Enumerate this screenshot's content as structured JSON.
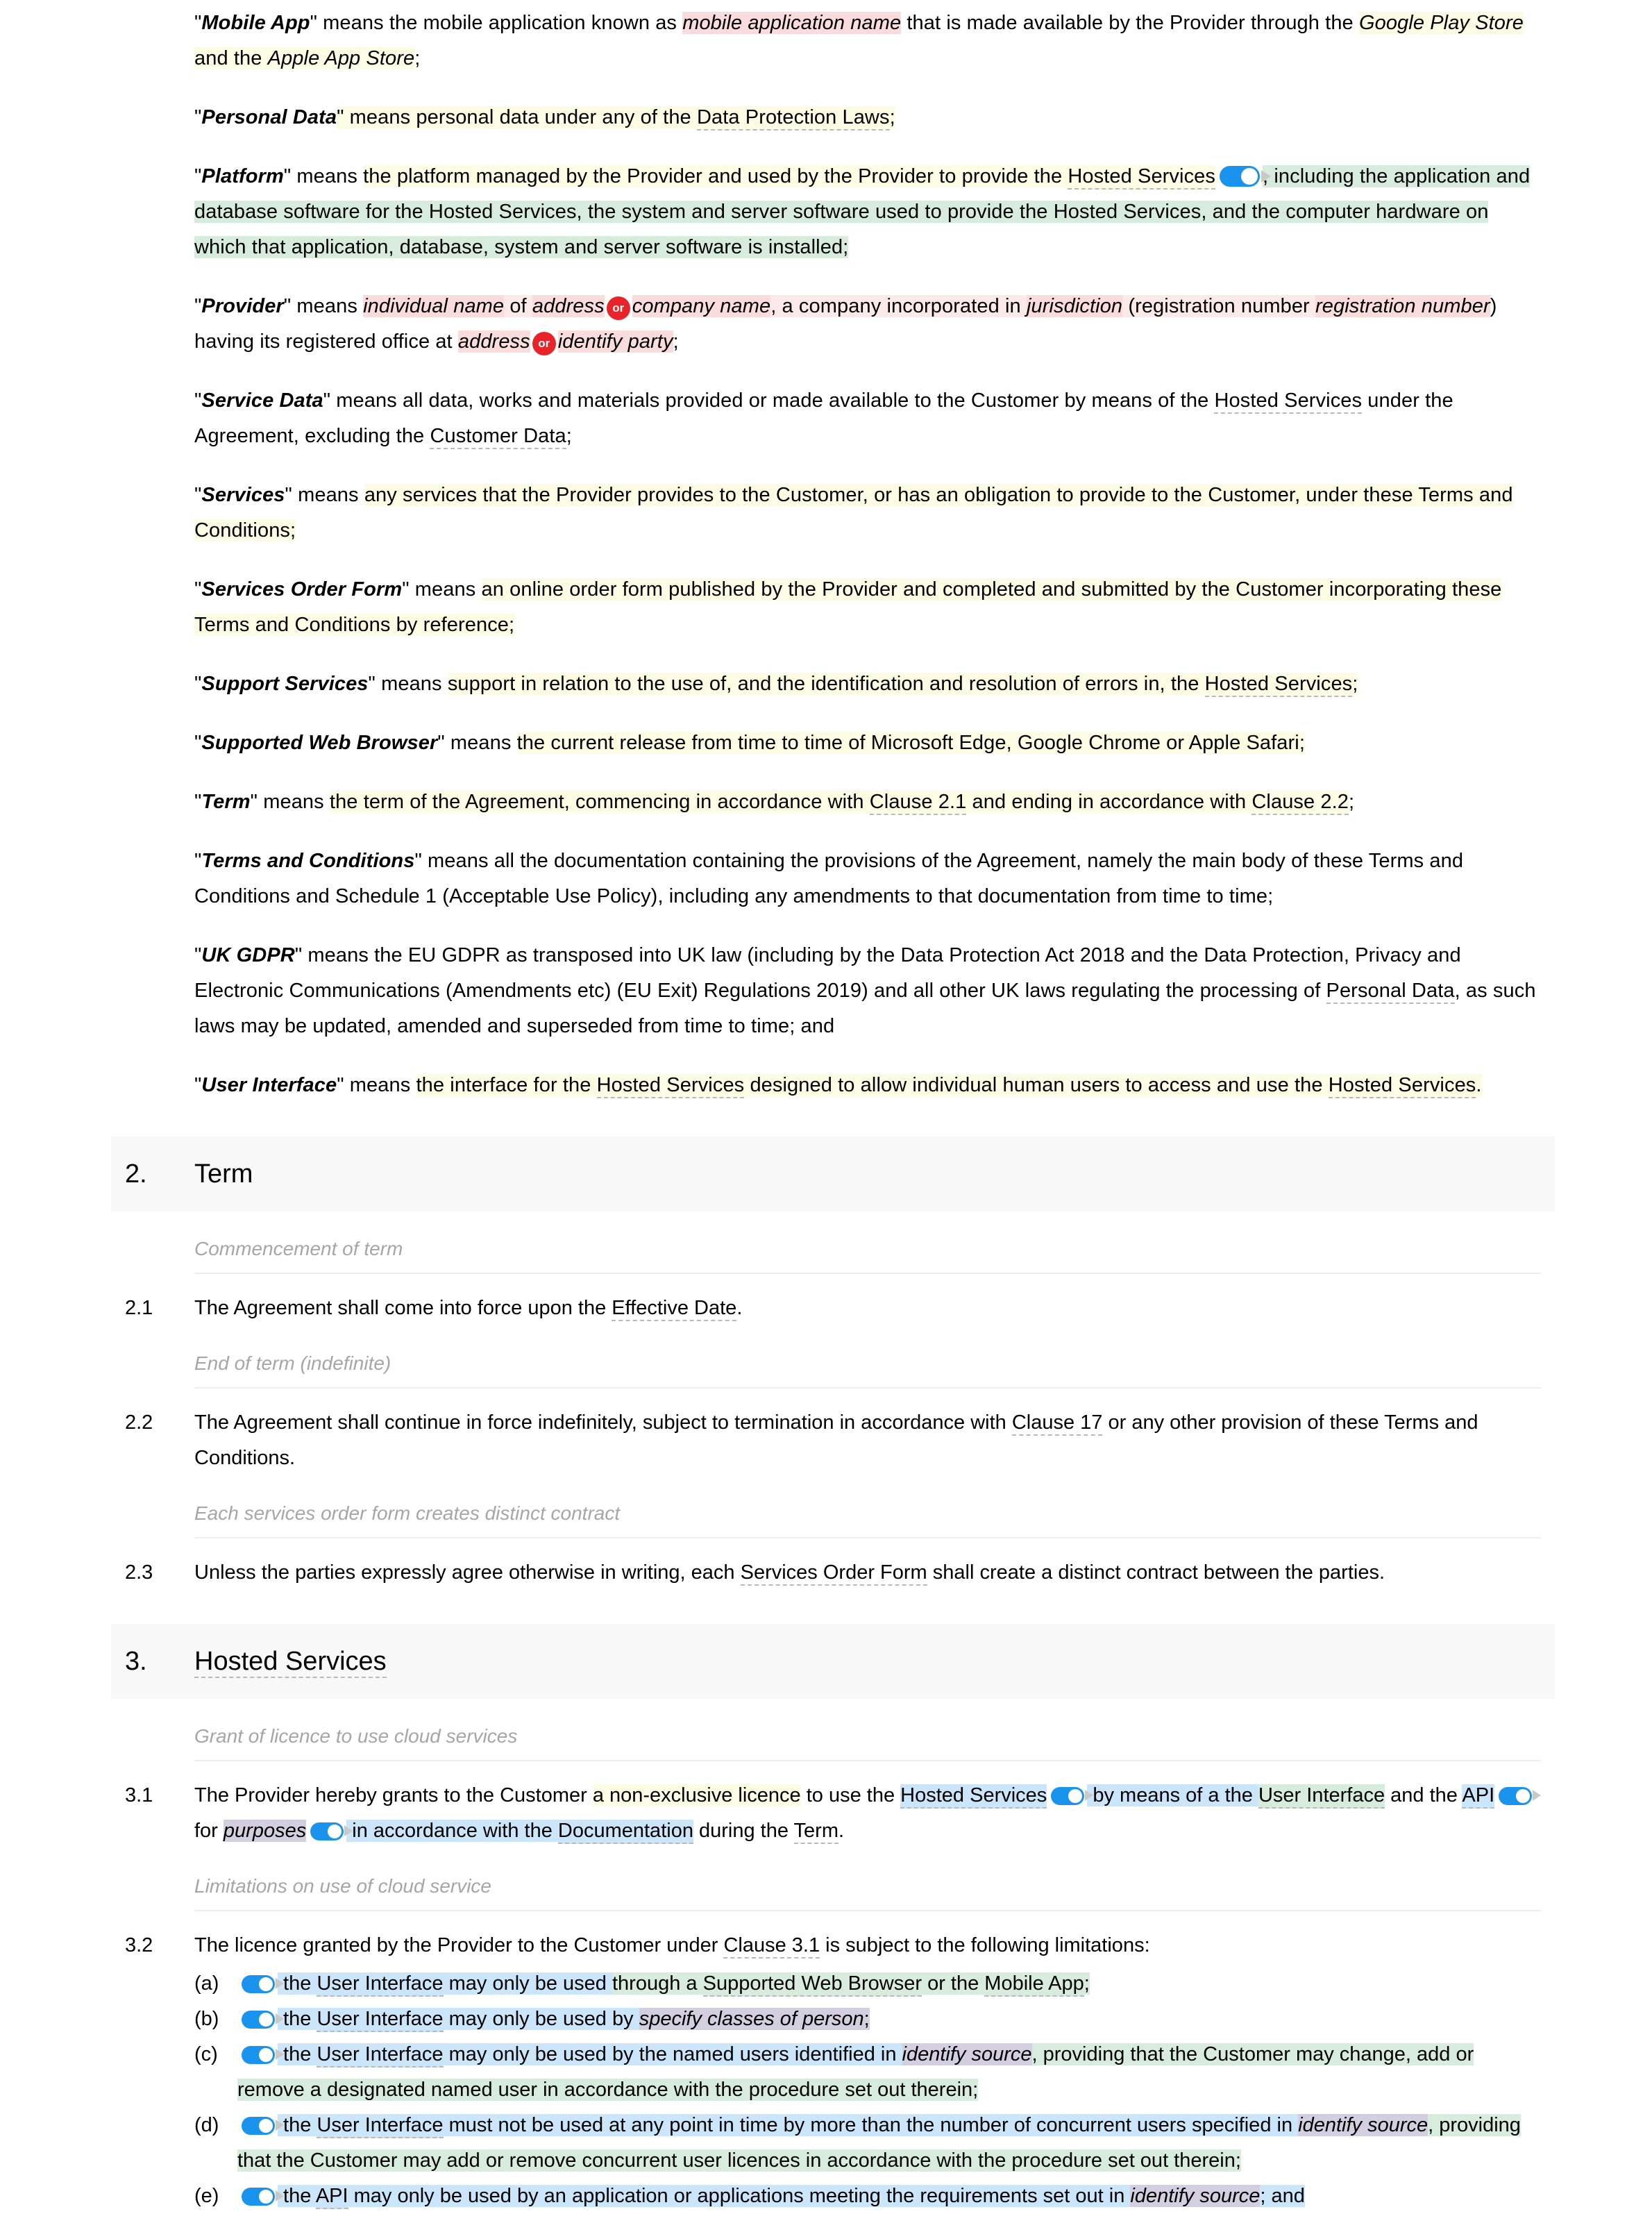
{
  "document": {
    "type": "legal-contract-template",
    "title": "Terms and Conditions — Definitions, Term, Hosted Services"
  },
  "colors": {
    "highlight_yellow": "#fcfbe3",
    "highlight_pink": "#fbdcdc",
    "highlight_pink_light": "#fceaea",
    "highlight_blue": "#cbe6fa",
    "highlight_green": "#d8ecdd",
    "highlight_purple": "#d4cfe0",
    "highlight_grey": "#eceef0",
    "toggle_on": "#1a93ef",
    "or_badge": "#e8232a",
    "section_band": "#f8f8f8",
    "dashed_underline": "#b9b9b9",
    "subheading_text": "#a6a6a6"
  },
  "definitions": [
    {
      "term": "Mobile App",
      "parts": [
        {
          "t": "\" ",
          "k": "quote-open"
        },
        {
          "t": "\" means the mobile application known as ",
          "k": "plain"
        },
        {
          "t": "mobile application name",
          "k": "pink-italic"
        },
        {
          "t": " that is made available by the Provider through the ",
          "k": "plain"
        },
        {
          "t": "Google Play Store",
          "k": "yellow-italic"
        },
        {
          "t": " and the ",
          "k": "yellow"
        },
        {
          "t": "Apple App Store",
          "k": "yellow-italic"
        },
        {
          "t": ";",
          "k": "plain"
        }
      ]
    },
    {
      "term": "Personal Data",
      "parts": [
        {
          "t": "\" means personal data under any of the ",
          "k": "yellow"
        },
        {
          "t": "Data Protection Laws",
          "k": "yellow-dt"
        },
        {
          "t": ";",
          "k": "yellow"
        }
      ]
    },
    {
      "term": "Platform",
      "parts": [
        {
          "t": "\" means ",
          "k": "plain"
        },
        {
          "t": "the platform managed by the Provider and used by the Provider to provide the ",
          "k": "yellow"
        },
        {
          "t": "Hosted Services",
          "k": "yellow-dt"
        },
        {
          "t": "TOGGLE",
          "k": "toggle-blue"
        },
        {
          "t": ", including the application and database software for the Hosted Services, the system and server software used to provide the Hosted Services, and the computer hardware on which that application, database, system and server software is installed;",
          "k": "green"
        }
      ]
    },
    {
      "term": "Provider",
      "parts": [
        {
          "t": "\" means ",
          "k": "plain"
        },
        {
          "t": "individual name",
          "k": "pink-italic"
        },
        {
          "t": " of ",
          "k": "pink-lt"
        },
        {
          "t": "address",
          "k": "pink-italic"
        },
        {
          "t": "OR",
          "k": "or-badge"
        },
        {
          "t": "company name",
          "k": "pink-italic"
        },
        {
          "t": ", a company incorporated in ",
          "k": "pink-lt"
        },
        {
          "t": "jurisdiction",
          "k": "pink-italic"
        },
        {
          "t": " (registration number ",
          "k": "pink-lt"
        },
        {
          "t": "registration number",
          "k": "pink-italic"
        },
        {
          "t": ") having its registered office at ",
          "k": "plain"
        },
        {
          "t": "address",
          "k": "pink-italic"
        },
        {
          "t": "OR",
          "k": "or-badge"
        },
        {
          "t": "identify party",
          "k": "pink-italic"
        },
        {
          "t": ";",
          "k": "plain"
        }
      ]
    },
    {
      "term": "Service Data",
      "parts": [
        {
          "t": "\" means all data, works and materials provided or made available to the Customer by means of the ",
          "k": "plain"
        },
        {
          "t": "Hosted Services",
          "k": "dt"
        },
        {
          "t": " under the Agreement, excluding the ",
          "k": "plain"
        },
        {
          "t": "Customer Data",
          "k": "dt"
        },
        {
          "t": ";",
          "k": "plain"
        }
      ]
    },
    {
      "term": "Services",
      "parts": [
        {
          "t": "\" means ",
          "k": "plain"
        },
        {
          "t": "any services that the Provider provides to the Customer, or has an obligation to provide to the Customer, under these Terms and Conditions;",
          "k": "yellow"
        }
      ]
    },
    {
      "term": "Services Order Form",
      "parts": [
        {
          "t": "\" means ",
          "k": "plain"
        },
        {
          "t": "an online order form published by the Provider and completed and submitted by the Customer incorporating these Terms and Conditions by reference;",
          "k": "yellow"
        }
      ]
    },
    {
      "term": "Support Services",
      "parts": [
        {
          "t": "\" means ",
          "k": "plain"
        },
        {
          "t": "support in relation to the use of, and the identification and resolution of errors in, the ",
          "k": "yellow"
        },
        {
          "t": "Hosted Services",
          "k": "yellow-dt"
        },
        {
          "t": ";",
          "k": "yellow"
        }
      ]
    },
    {
      "term": "Supported Web Browser",
      "parts": [
        {
          "t": "\" means ",
          "k": "plain"
        },
        {
          "t": "the current release from time to time of Microsoft Edge, Google Chrome or Apple Safari;",
          "k": "yellow"
        }
      ]
    },
    {
      "term": "Term",
      "parts": [
        {
          "t": "\" means ",
          "k": "plain"
        },
        {
          "t": "the term of the Agreement, commencing in accordance with ",
          "k": "yellow"
        },
        {
          "t": "Clause 2.1",
          "k": "yellow-dt"
        },
        {
          "t": " and ending in accordance with ",
          "k": "yellow"
        },
        {
          "t": "Clause 2.2",
          "k": "yellow-dt"
        },
        {
          "t": ";",
          "k": "plain"
        }
      ]
    },
    {
      "term": "Terms and Conditions",
      "parts": [
        {
          "t": "\" means all the documentation containing the provisions of the Agreement, namely the main body of these Terms and Conditions and Schedule 1 (Acceptable Use Policy), including any amendments to that documentation from time to time;",
          "k": "plain"
        }
      ]
    },
    {
      "term": "UK GDPR",
      "parts": [
        {
          "t": "\" means the EU GDPR as transposed into UK law (including by the Data Protection Act 2018 and the Data Protection, Privacy and Electronic Communications (Amendments etc) (EU Exit) Regulations 2019) and all other UK laws regulating the processing of ",
          "k": "plain"
        },
        {
          "t": "Personal Data",
          "k": "dt"
        },
        {
          "t": ", as such laws may be updated, amended and superseded from time to time; and",
          "k": "plain"
        }
      ]
    },
    {
      "term": "User Interface",
      "parts": [
        {
          "t": "\" means ",
          "k": "plain"
        },
        {
          "t": "the interface for the ",
          "k": "yellow"
        },
        {
          "t": "Hosted Services",
          "k": "yellow-dt"
        },
        {
          "t": " designed to allow individual human users to access and use the ",
          "k": "yellow"
        },
        {
          "t": "Hosted Services",
          "k": "yellow-dt"
        },
        {
          "t": ".",
          "k": "yellow"
        }
      ]
    }
  ],
  "section_2": {
    "number": "2.",
    "title": "Term",
    "groups": [
      {
        "subheading": "Commencement of term",
        "clauses": [
          {
            "number": "2.1",
            "parts": [
              {
                "t": "The Agreement shall come into force upon the ",
                "k": "plain"
              },
              {
                "t": "Effective Date",
                "k": "dt"
              },
              {
                "t": ".",
                "k": "plain"
              }
            ]
          }
        ]
      },
      {
        "subheading": "End of term (indefinite)",
        "clauses": [
          {
            "number": "2.2",
            "parts": [
              {
                "t": "The Agreement shall continue in force indefinitely, subject to termination in accordance with ",
                "k": "plain"
              },
              {
                "t": "Clause 17",
                "k": "dt"
              },
              {
                "t": " or any other provision of these Terms and Conditions.",
                "k": "plain"
              }
            ]
          }
        ]
      },
      {
        "subheading": "Each services order form creates distinct contract",
        "clauses": [
          {
            "number": "2.3",
            "parts": [
              {
                "t": "Unless the parties expressly agree otherwise in writing, each ",
                "k": "plain"
              },
              {
                "t": "Services Order Form",
                "k": "dt"
              },
              {
                "t": " shall create a distinct contract between the parties.",
                "k": "plain"
              }
            ]
          }
        ]
      }
    ]
  },
  "section_3": {
    "number": "3.",
    "title": "Hosted Services",
    "title_is_defined_term": true,
    "groups": [
      {
        "subheading": "Grant of licence to use cloud services",
        "clauses": [
          {
            "number": "3.1",
            "parts": [
              {
                "t": "The Provider hereby grants to the Customer ",
                "k": "plain"
              },
              {
                "t": "a non-exclusive licence",
                "k": "yellow"
              },
              {
                "t": " to use the ",
                "k": "plain"
              },
              {
                "t": "Hosted Services",
                "k": "blue-dt"
              },
              {
                "t": "TOGGLE",
                "k": "toggle-blue-sm"
              },
              {
                "t": " by means of a the ",
                "k": "blue"
              },
              {
                "t": "User Interface",
                "k": "green-dt"
              },
              {
                "t": " and the ",
                "k": "plain"
              },
              {
                "t": "API",
                "k": "blue-dt"
              },
              {
                "t": "TOGGLE",
                "k": "toggle-blue-sm"
              },
              {
                "t": " for ",
                "k": "plain"
              },
              {
                "t": "purposes",
                "k": "purple-italic"
              },
              {
                "t": "TOGGLE",
                "k": "toggle-blue-sm"
              },
              {
                "t": " in accordance with the ",
                "k": "blue"
              },
              {
                "t": "Documentation",
                "k": "blue-dt"
              },
              {
                "t": " during the ",
                "k": "plain"
              },
              {
                "t": "Term",
                "k": "dt"
              },
              {
                "t": ".",
                "k": "plain"
              }
            ]
          }
        ]
      },
      {
        "subheading": "Limitations on use of cloud service",
        "clauses": [
          {
            "number": "3.2",
            "parts": [
              {
                "t": "The licence granted by the Provider to the Customer under ",
                "k": "plain"
              },
              {
                "t": "Clause 3.1",
                "k": "dt"
              },
              {
                "t": " is subject to the following limitations:",
                "k": "plain"
              }
            ],
            "sublist": [
              {
                "letter": "(a)",
                "parts": [
                  {
                    "t": "TOGGLE",
                    "k": "toggle-blue-sm"
                  },
                  {
                    "t": " the ",
                    "k": "blue"
                  },
                  {
                    "t": "User Interface",
                    "k": "blue-dt"
                  },
                  {
                    "t": " may only be used ",
                    "k": "blue"
                  },
                  {
                    "t": "through a ",
                    "k": "green"
                  },
                  {
                    "t": "Supported Web Browser",
                    "k": "green-dt"
                  },
                  {
                    "t": " or the ",
                    "k": "green"
                  },
                  {
                    "t": "Mobile App",
                    "k": "green-dt"
                  },
                  {
                    "t": ";",
                    "k": "green"
                  }
                ]
              },
              {
                "letter": "(b)",
                "parts": [
                  {
                    "t": "TOGGLE",
                    "k": "toggle-blue-sm"
                  },
                  {
                    "t": " the ",
                    "k": "blue"
                  },
                  {
                    "t": "User Interface",
                    "k": "blue-dt"
                  },
                  {
                    "t": " may only be used by ",
                    "k": "blue"
                  },
                  {
                    "t": "specify classes of person",
                    "k": "purple-italic"
                  },
                  {
                    "t": ";",
                    "k": "purple"
                  }
                ]
              },
              {
                "letter": "(c)",
                "parts": [
                  {
                    "t": "TOGGLE",
                    "k": "toggle-blue-sm"
                  },
                  {
                    "t": " the ",
                    "k": "blue"
                  },
                  {
                    "t": "User Interface",
                    "k": "blue-dt"
                  },
                  {
                    "t": " may only be used by the named users identified in ",
                    "k": "blue"
                  },
                  {
                    "t": "identify source",
                    "k": "purple-italic"
                  },
                  {
                    "t": ", providing that the Customer may change, add or remove a designated named user in accordance with the procedure set out therein;",
                    "k": "green"
                  }
                ]
              },
              {
                "letter": "(d)",
                "parts": [
                  {
                    "t": "TOGGLE",
                    "k": "toggle-blue-sm"
                  },
                  {
                    "t": " the ",
                    "k": "blue"
                  },
                  {
                    "t": "User Interface",
                    "k": "blue-dt"
                  },
                  {
                    "t": " must not be used at any point in time by more than the number of concurrent users specified in ",
                    "k": "blue"
                  },
                  {
                    "t": "identify source",
                    "k": "purple-italic"
                  },
                  {
                    "t": ", providing that the Customer may add or remove concurrent user licences in accordance with the procedure set out therein;",
                    "k": "green"
                  }
                ]
              },
              {
                "letter": "(e)",
                "parts": [
                  {
                    "t": "TOGGLE",
                    "k": "toggle-blue-sm"
                  },
                  {
                    "t": " the ",
                    "k": "blue"
                  },
                  {
                    "t": "API",
                    "k": "blue-dt"
                  },
                  {
                    "t": " may only be used by an application or applications meeting the requirements set out in ",
                    "k": "blue"
                  },
                  {
                    "t": "identify source",
                    "k": "purple-italic"
                  },
                  {
                    "t": "; and",
                    "k": "blue"
                  }
                ]
              }
            ]
          }
        ]
      }
    ]
  }
}
